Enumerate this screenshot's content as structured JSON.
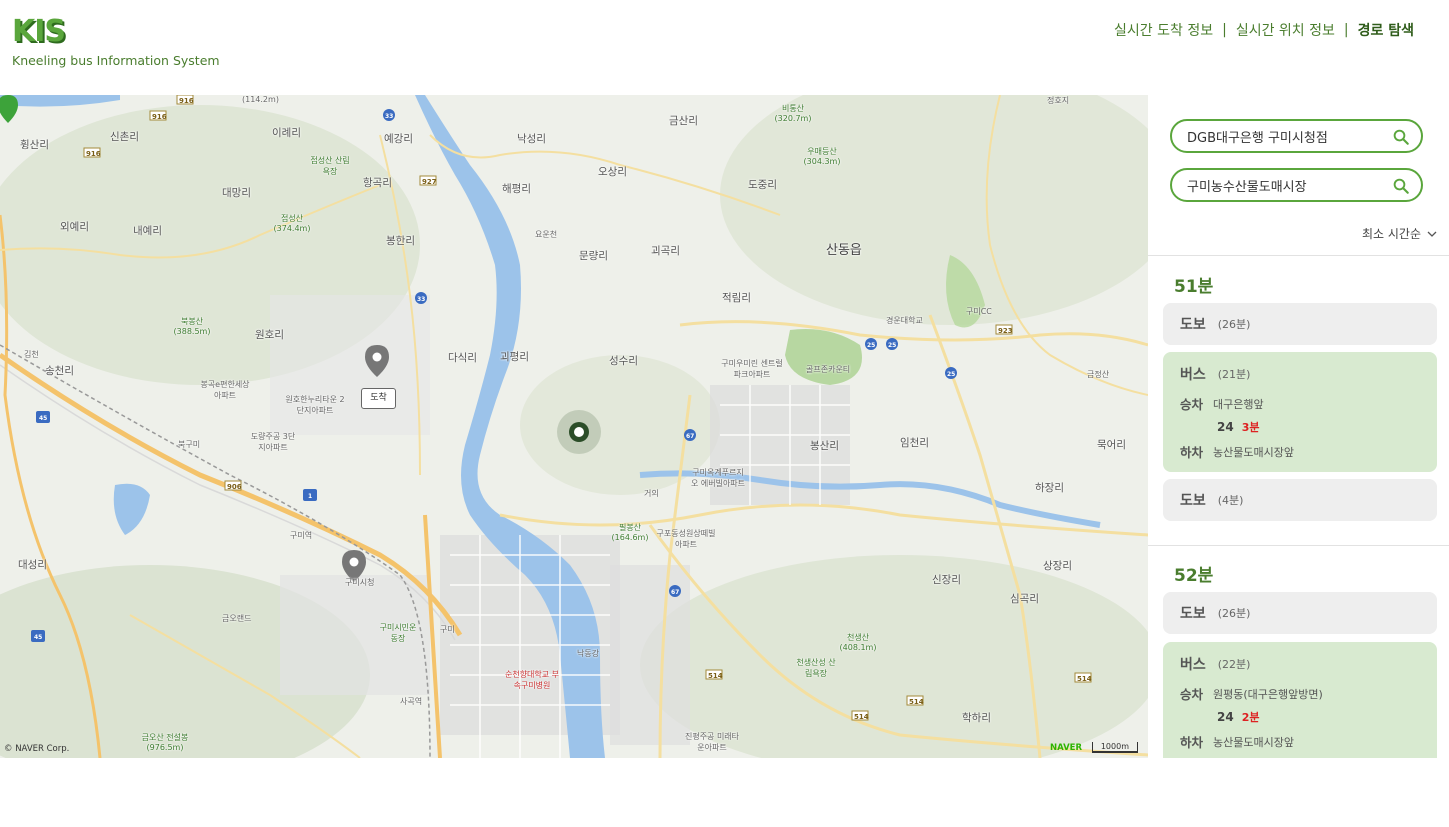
{
  "header": {
    "logo": "KIS",
    "subtitle": "Kneeling bus Information System",
    "nav": [
      {
        "label": "실시간 도착 정보",
        "active": false
      },
      {
        "label": "실시간 위치 정보",
        "active": false
      },
      {
        "label": "경로 탐색",
        "active": true
      }
    ],
    "separator": "|"
  },
  "map": {
    "labels": {
      "sandong": "산동읍",
      "hwangsan": "휭산리",
      "singchon": "신촌리",
      "irye": "이례리",
      "yegang": "예강리",
      "nakseong": "낙성리",
      "geumsan": "금산리",
      "osang": "오상리",
      "dojung": "도중리",
      "daemang": "대망리",
      "oeyere": "외예리",
      "naeyere": "내예리",
      "hanggok": "항곡리",
      "haepyeong": "해평리",
      "bonghan": "봉한리",
      "munryang": "문량리",
      "goegok": "괴곡리",
      "jeokrim": "적림리",
      "wonho": "원호리",
      "dasik": "다식리",
      "goepyeong": "괴평리",
      "seongsu": "성수리",
      "imcheon": "임천리",
      "bongsan": "봉산리",
      "mukeo": "묵어리",
      "hajang": "하장리",
      "daeseong": "대성리",
      "sinjang": "신장리",
      "simgok": "심곡리",
      "sangjang": "상장리",
      "hakha": "학하리",
      "nakdonggang": "낙동강",
      "songcheon": "송천리",
      "gumi_station": "구미역",
      "gumi_city": "구미시청",
      "sagok": "사곡역",
      "geumo_land": "금오랜드",
      "gumi_stadium": "구미시민운동장",
      "gyeongun": "경운대학교",
      "gumi_cc": "구미CC",
      "golf": "골프존카운티",
      "hospital": "순천향대학교 부속구미병원",
      "bonggok": "봉곡e편한세상아파트",
      "wonho_apt": "원호한누리타운 2단지아파트",
      "doryang": "도량주공 3단지아파트",
      "gumi_apt": "구미우미린 센트럴파크아파트",
      "oksan_apt": "구미옥계푸르지오 에버빌아파트",
      "gupo_apt": "구포동성원상떼빌 아파트",
      "jinpyeong": "진평주공 미래타운아파트",
      "jeopseong": "접성산 (374.4m)",
      "bukbong": "북봉산 (388.5m)",
      "chunseong": "천생산 (408.1m)",
      "pilbong": "필봉산 (164.6m)",
      "geumosan": "금오산 전설봉(976.5m)",
      "bitong": "비통산 (320.7m)",
      "umaedeung": "우매등산 (304.3m)",
      "jeopseong_forest": "접성산 산림욕장",
      "chunseong_forest": "천생산성 산림욕장",
      "gumi_ic": "구미",
      "bukgumi_ic": "북구미",
      "gumi_ic2": "거의",
      "gimcheon": "김천",
      "yongjeon": "요운천",
      "chaeksan": "(114.2m)",
      "jeongbyeong": "정호지",
      "geumgeonsan": "금정산"
    },
    "arrive_tag": "도착",
    "copyright": "© NAVER Corp.",
    "naver": "NAVER",
    "scale": "1000m",
    "route_numbers": [
      "916",
      "916",
      "916",
      "33",
      "33",
      "927",
      "25",
      "25",
      "25",
      "923",
      "67",
      "67",
      "906",
      "1",
      "45",
      "45",
      "514",
      "514",
      "514",
      "514"
    ]
  },
  "sidebar": {
    "origin": "DGB대구은행 구미시청점",
    "destination": "구미농수산물도매시장",
    "sort_label": "최소 시간순",
    "routes": [
      {
        "total": "51분",
        "walk1": {
          "mode": "도보",
          "dur": "(26분)"
        },
        "bus": {
          "mode": "버스",
          "dur": "(21분)",
          "board_label": "승차",
          "board": "대구은행앞",
          "line": "24",
          "eta": "3분",
          "alight_label": "하차",
          "alight": "농산물도매시장앞"
        },
        "walk2": {
          "mode": "도보",
          "dur": "(4분)"
        }
      },
      {
        "total": "52분",
        "walk1": {
          "mode": "도보",
          "dur": "(26분)"
        },
        "bus": {
          "mode": "버스",
          "dur": "(22분)",
          "board_label": "승차",
          "board": "원평동(대구은행앞방면)",
          "line": "24",
          "eta": "2분",
          "alight_label": "하차",
          "alight": "농산물도매시장앞"
        }
      }
    ]
  },
  "colors": {
    "accent": "#5aa63c",
    "brand_dark": "#4a7d2e",
    "bus_card": "#d8ead0",
    "walk_card": "#eeeeee",
    "eta": "#dd2222",
    "river": "#9cc3ea"
  }
}
